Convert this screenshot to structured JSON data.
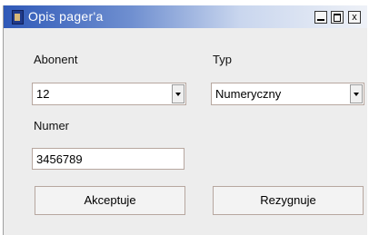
{
  "window": {
    "title": "Opis pager'a",
    "controls": {
      "minimize": "_",
      "maximize": "□",
      "close": "x"
    }
  },
  "form": {
    "abonent": {
      "label": "Abonent",
      "value": "12"
    },
    "typ": {
      "label": "Typ",
      "value": "Numeryczny"
    },
    "numer": {
      "label": "Numer",
      "value": "3456789"
    }
  },
  "buttons": {
    "accept": "Akceptuje",
    "cancel": "Rezygnuje"
  },
  "icons": {
    "app": "app-icon",
    "dropdown": "chevron-down-icon"
  }
}
